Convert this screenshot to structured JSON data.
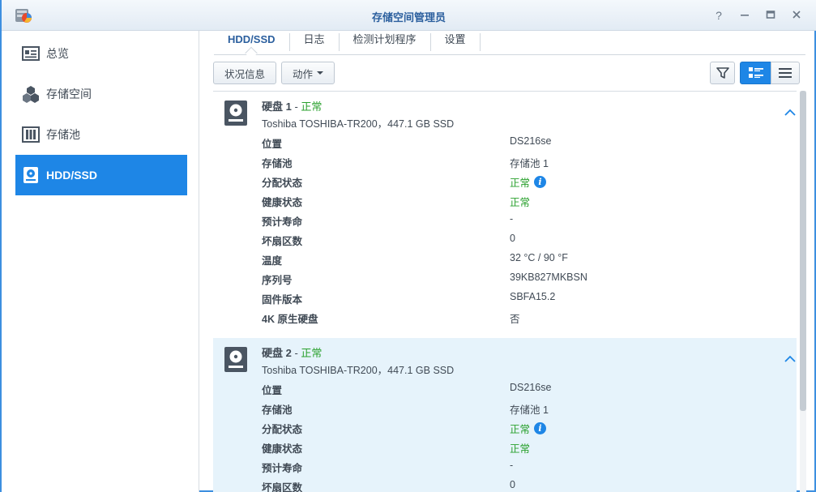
{
  "window": {
    "title": "存储空间管理员"
  },
  "sidebar": {
    "items": [
      {
        "label": "总览"
      },
      {
        "label": "存储空间"
      },
      {
        "label": "存储池"
      },
      {
        "label": "HDD/SSD"
      }
    ]
  },
  "tabs": [
    {
      "label": "HDD/SSD"
    },
    {
      "label": "日志"
    },
    {
      "label": "检测计划程序"
    },
    {
      "label": "设置"
    }
  ],
  "toolbar": {
    "status_label": "状况信息",
    "action_label": "动作"
  },
  "disks": [
    {
      "name": "硬盘 1",
      "separator": " - ",
      "status": "正常",
      "model": "Toshiba TOSHIBA-TR200，447.1 GB SSD",
      "rows": [
        {
          "k": "位置",
          "v": "DS216se"
        },
        {
          "k": "存储池",
          "v": "存储池 1"
        },
        {
          "k": "分配状态",
          "v": "正常"
        },
        {
          "k": "健康状态",
          "v": "正常"
        },
        {
          "k": "预计寿命",
          "v": "-"
        },
        {
          "k": "坏扇区数",
          "v": "0"
        },
        {
          "k": "温度",
          "v": "32 °C / 90 °F"
        },
        {
          "k": "序列号",
          "v": "39KB827MKBSN"
        },
        {
          "k": "固件版本",
          "v": "SBFA15.2"
        },
        {
          "k": "4K 原生硬盘",
          "v": "否"
        }
      ]
    },
    {
      "name": "硬盘 2",
      "separator": " - ",
      "status": "正常",
      "model": "Toshiba TOSHIBA-TR200，447.1 GB SSD",
      "rows": [
        {
          "k": "位置",
          "v": "DS216se"
        },
        {
          "k": "存储池",
          "v": "存储池 1"
        },
        {
          "k": "分配状态",
          "v": "正常"
        },
        {
          "k": "健康状态",
          "v": "正常"
        },
        {
          "k": "预计寿命",
          "v": "-"
        },
        {
          "k": "坏扇区数",
          "v": "0"
        }
      ]
    }
  ],
  "colors": {
    "accent": "#1e86e6",
    "ok": "#29a02d",
    "selected_bg": "#e6f3fb"
  }
}
